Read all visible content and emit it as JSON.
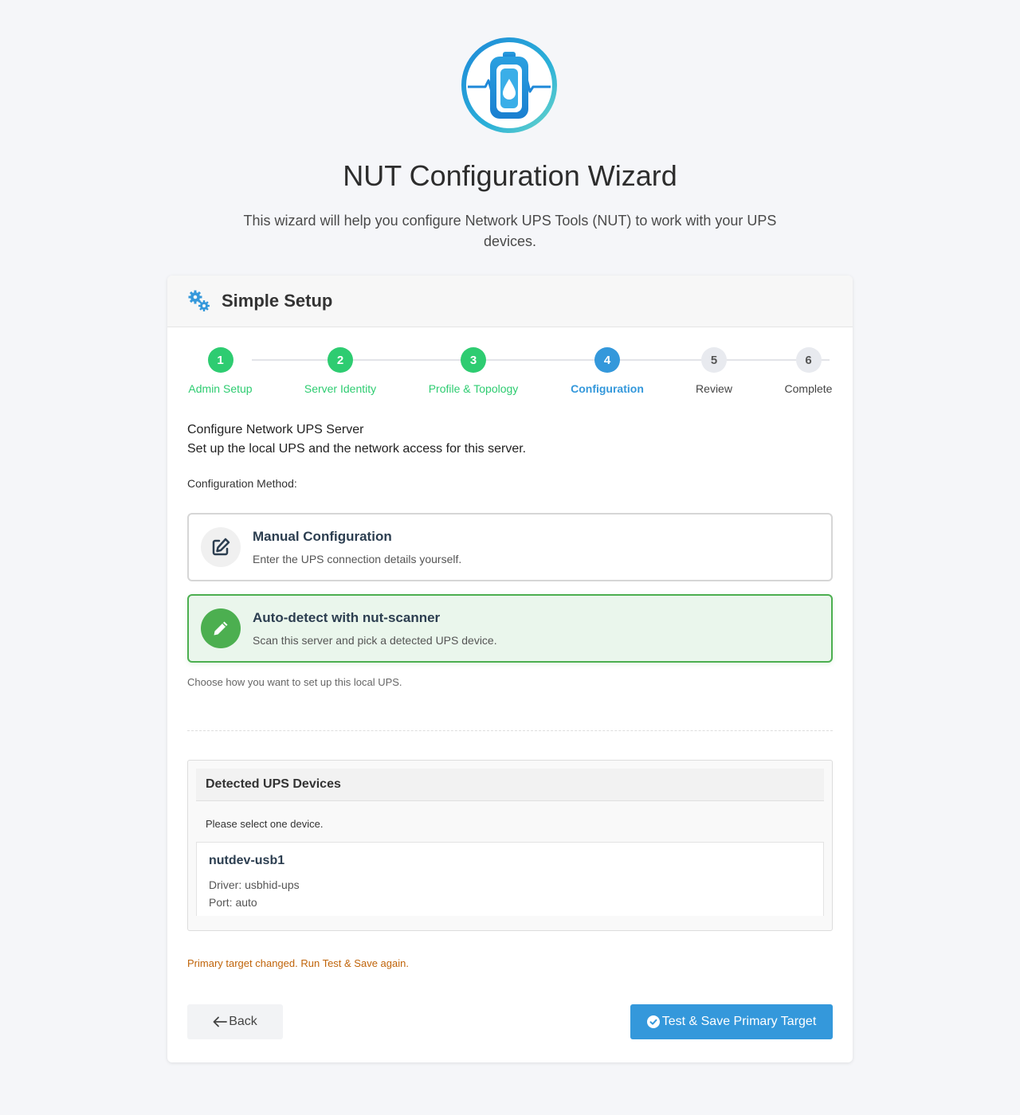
{
  "header": {
    "title": "NUT Configuration Wizard",
    "subtitle": "This wizard will help you configure Network UPS Tools (NUT) to work with your UPS devices."
  },
  "card": {
    "title": "Simple Setup",
    "icon": "gears-icon"
  },
  "steps": [
    {
      "number": "1",
      "label": "Admin Setup",
      "state": "done"
    },
    {
      "number": "2",
      "label": "Server Identity",
      "state": "done"
    },
    {
      "number": "3",
      "label": "Profile & Topology",
      "state": "done"
    },
    {
      "number": "4",
      "label": "Configuration",
      "state": "active"
    },
    {
      "number": "5",
      "label": "Review",
      "state": "todo"
    },
    {
      "number": "6",
      "label": "Complete",
      "state": "todo"
    }
  ],
  "section": {
    "title": "Configure Network UPS Server",
    "description": "Set up the local UPS and the network access for this server.",
    "method_label": "Configuration Method:"
  },
  "options": [
    {
      "title": "Manual Configuration",
      "description": "Enter the UPS connection details yourself.",
      "icon": "edit-icon",
      "selected": false
    },
    {
      "title": "Auto-detect with nut-scanner",
      "description": "Scan this server and pick a detected UPS device.",
      "icon": "pencil-icon",
      "selected": true
    }
  ],
  "method_help": "Choose how you want to set up this local UPS.",
  "detected": {
    "title": "Detected UPS Devices",
    "hint": "Please select one device.",
    "devices": [
      {
        "name": "nutdev-usb1",
        "driver": "Driver: usbhid-ups",
        "port": "Port: auto"
      }
    ]
  },
  "warning": "Primary target changed. Run Test & Save again.",
  "buttons": {
    "back": "Back",
    "save": "Test & Save Primary Target"
  },
  "colors": {
    "done": "#2ecc71",
    "active": "#3498db",
    "selected_border": "#4caf50",
    "warning": "#c0640a"
  }
}
